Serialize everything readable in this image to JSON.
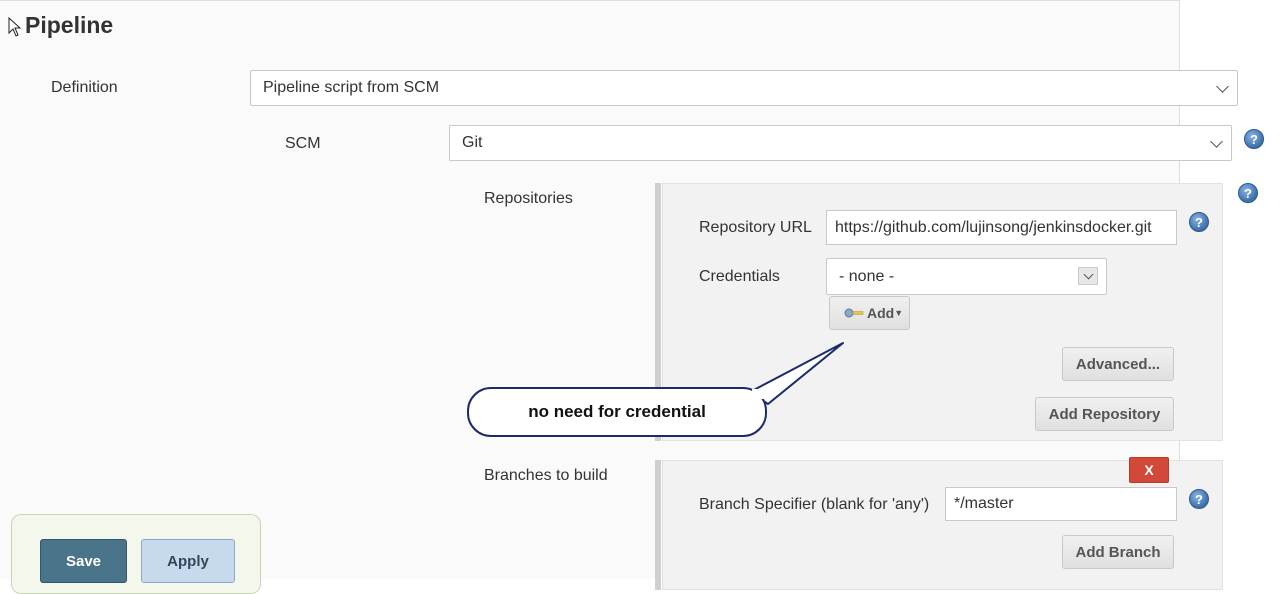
{
  "section": {
    "title": "Pipeline"
  },
  "definition": {
    "label": "Definition",
    "value": "Pipeline script from SCM"
  },
  "scm": {
    "label": "SCM",
    "value": "Git",
    "help": "?"
  },
  "repositories": {
    "label": "Repositories",
    "help": "?",
    "url_label": "Repository URL",
    "url_value": "https://github.com/lujinsong/jenkinsdocker.git",
    "url_help": "?",
    "credentials_label": "Credentials",
    "credentials_value": "- none -",
    "add_label": "Add",
    "advanced_label": "Advanced...",
    "add_repository_label": "Add Repository"
  },
  "callout": {
    "text": "no need for credential"
  },
  "branches": {
    "label": "Branches to build",
    "delete_label": "X",
    "specifier_label": "Branch Specifier (blank for 'any')",
    "specifier_value": "*/master",
    "specifier_help": "?",
    "add_branch_label": "Add Branch"
  },
  "footer": {
    "save_label": "Save",
    "apply_label": "Apply"
  },
  "colors": {
    "save_bg": "#4a7489",
    "apply_bg": "#c7d9ed",
    "delete_bg": "#d24939",
    "callout_border": "#1a2a6c"
  }
}
